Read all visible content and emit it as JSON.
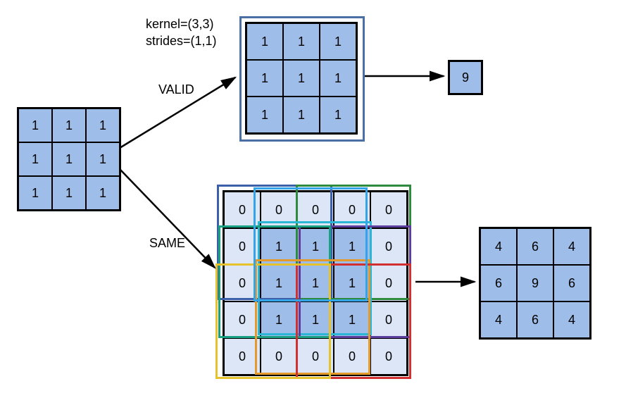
{
  "params": {
    "kernel_line": "kernel=(3,3)",
    "strides_line": "strides=(1,1)"
  },
  "labels": {
    "valid": "VALID",
    "same": "SAME"
  },
  "input_grid": [
    [
      "1",
      "1",
      "1"
    ],
    [
      "1",
      "1",
      "1"
    ],
    [
      "1",
      "1",
      "1"
    ]
  ],
  "valid_kernel_grid": [
    [
      "1",
      "1",
      "1"
    ],
    [
      "1",
      "1",
      "1"
    ],
    [
      "1",
      "1",
      "1"
    ]
  ],
  "valid_output": "9",
  "same_padded_grid": [
    [
      "0",
      "0",
      "0",
      "0",
      "0"
    ],
    [
      "0",
      "1",
      "1",
      "1",
      "0"
    ],
    [
      "0",
      "1",
      "1",
      "1",
      "0"
    ],
    [
      "0",
      "1",
      "1",
      "1",
      "0"
    ],
    [
      "0",
      "0",
      "0",
      "0",
      "0"
    ]
  ],
  "same_output_grid": [
    [
      "4",
      "6",
      "4"
    ],
    [
      "6",
      "9",
      "6"
    ],
    [
      "4",
      "6",
      "4"
    ]
  ],
  "chart_data": {
    "type": "diagram",
    "description": "Convolution padding modes VALID vs SAME",
    "input": [
      [
        1,
        1,
        1
      ],
      [
        1,
        1,
        1
      ],
      [
        1,
        1,
        1
      ]
    ],
    "kernel_size": [
      3,
      3
    ],
    "strides": [
      1,
      1
    ],
    "valid_output": [
      [
        9
      ]
    ],
    "same_padded_input": [
      [
        0,
        0,
        0,
        0,
        0
      ],
      [
        0,
        1,
        1,
        1,
        0
      ],
      [
        0,
        1,
        1,
        1,
        0
      ],
      [
        0,
        1,
        1,
        1,
        0
      ],
      [
        0,
        0,
        0,
        0,
        0
      ]
    ],
    "same_output": [
      [
        4,
        6,
        4
      ],
      [
        6,
        9,
        6
      ],
      [
        4,
        6,
        4
      ]
    ]
  },
  "overlay_colors": {
    "blue": "#3b5fa8",
    "green": "#2e8b3e",
    "cyan": "#2bb6d6",
    "purple": "#5d3e9e",
    "orange": "#e39a2a",
    "red": "#d23030",
    "yellow": "#e6c22d",
    "lightblue": "#34a4e8",
    "teal": "#1aa183"
  }
}
